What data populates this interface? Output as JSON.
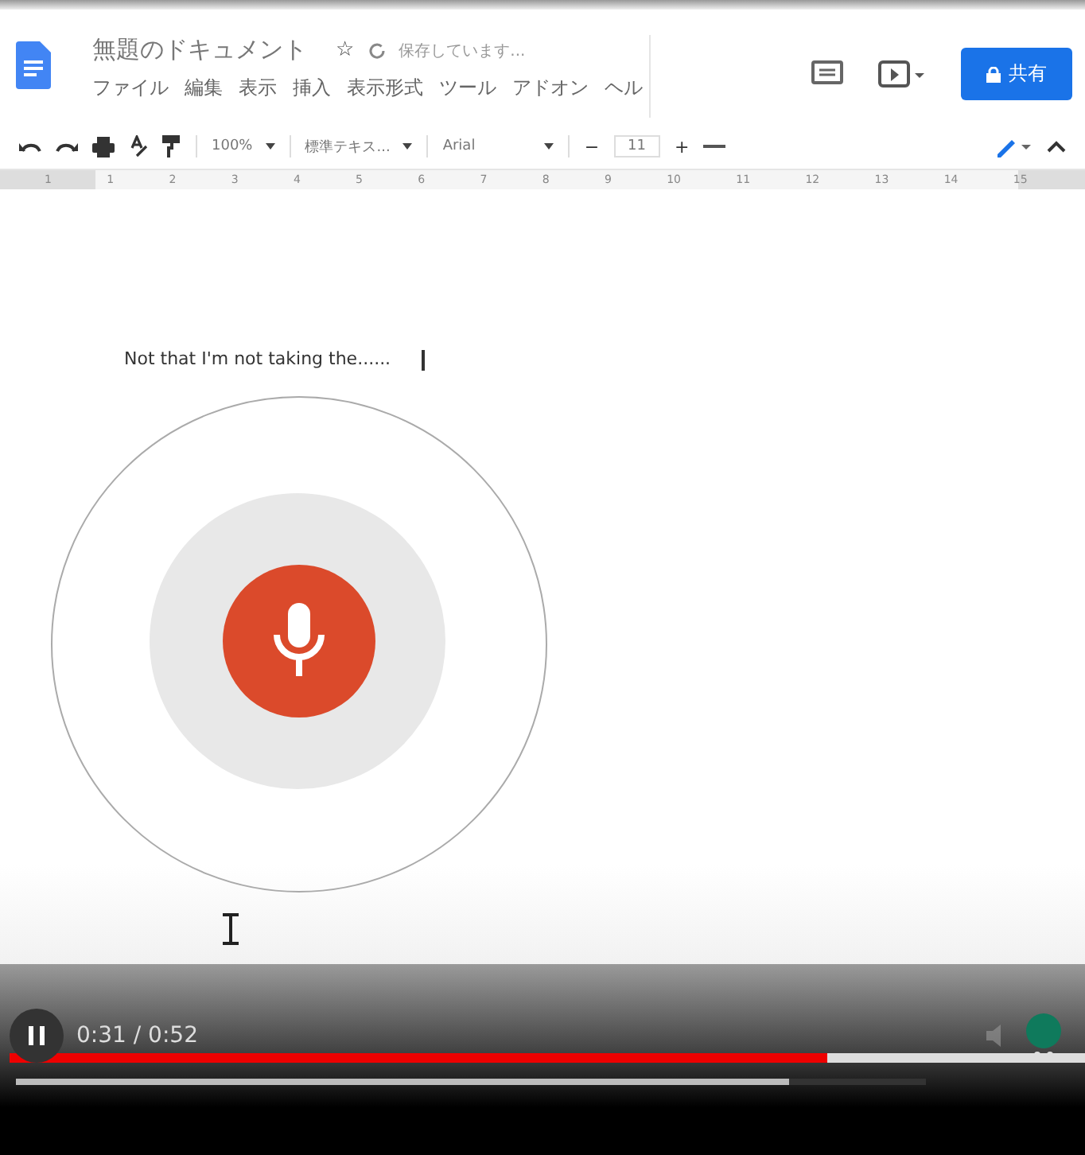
{
  "document": {
    "title": "無題のドキュメント",
    "star": "☆",
    "save_status": "保存しています..."
  },
  "menu": [
    "ファイル",
    "編集",
    "表示",
    "挿入",
    "表示形式",
    "ツール",
    "アドオン",
    "ヘル"
  ],
  "share_button": "共有",
  "toolbar": {
    "zoom": "100%",
    "style": "標準テキス...",
    "font": "Arial",
    "font_size": "11",
    "minus": "−",
    "plus": "+"
  },
  "ruler": [
    "1",
    "1",
    "2",
    "3",
    "4",
    "5",
    "6",
    "7",
    "8",
    "9",
    "10",
    "11",
    "12",
    "13",
    "14",
    "15"
  ],
  "body_text": "Not that I'm not taking the......",
  "player": {
    "time": "0:31 / 0:52",
    "playing": true,
    "progress": {
      "level": 0.76
    },
    "buffer": {
      "level": 0.85
    }
  }
}
